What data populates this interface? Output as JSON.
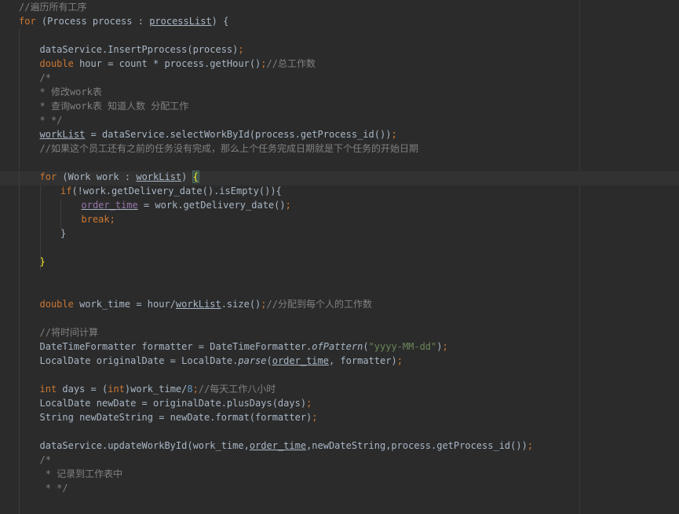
{
  "editor": {
    "lines": [
      {
        "i": 0,
        "text": "//遍历所有工序"
      },
      {
        "i": 0,
        "text": "for (Process process : processList) {"
      },
      {
        "i": 1,
        "text": ""
      },
      {
        "i": 1,
        "text": "dataService.InsertPprocess(process);"
      },
      {
        "i": 1,
        "text": "double hour = count * process.getHour();//总工作数"
      },
      {
        "i": 1,
        "text": "/*"
      },
      {
        "i": 1,
        "text": "* 修改work表"
      },
      {
        "i": 1,
        "text": "* 查询work表 知道人数 分配工作"
      },
      {
        "i": 1,
        "text": "* */"
      },
      {
        "i": 1,
        "text": "workList = dataService.selectWorkById(process.getProcess_id());"
      },
      {
        "i": 1,
        "text": "//如果这个员工还有之前的任务没有完成，那么上个任务完成日期就是下个任务的开始日期"
      },
      {
        "i": 1,
        "text": ""
      },
      {
        "i": 1,
        "text": "for (Work work : workList) {"
      },
      {
        "i": 2,
        "text": "if(!work.getDelivery_date().isEmpty()){"
      },
      {
        "i": 3,
        "text": "order_time = work.getDelivery_date();"
      },
      {
        "i": 3,
        "text": "break;"
      },
      {
        "i": 2,
        "text": "}"
      },
      {
        "i": 1,
        "text": ""
      },
      {
        "i": 1,
        "text": "}"
      },
      {
        "i": 1,
        "text": ""
      },
      {
        "i": 1,
        "text": ""
      },
      {
        "i": 1,
        "text": "double work_time = hour/workList.size();//分配到每个人的工作数"
      },
      {
        "i": 1,
        "text": ""
      },
      {
        "i": 1,
        "text": "//将时间计算"
      },
      {
        "i": 1,
        "text": "DateTimeFormatter formatter = DateTimeFormatter.ofPattern(\"yyyy-MM-dd\");"
      },
      {
        "i": 1,
        "text": "LocalDate originalDate = LocalDate.parse(order_time, formatter);"
      },
      {
        "i": 1,
        "text": ""
      },
      {
        "i": 1,
        "text": "int days = (int)work_time/8;//每天工作八小时"
      },
      {
        "i": 1,
        "text": "LocalDate newDate = originalDate.plusDays(days);"
      },
      {
        "i": 1,
        "text": "String newDateString = newDate.format(formatter);"
      },
      {
        "i": 1,
        "text": ""
      },
      {
        "i": 1,
        "text": "dataService.updateWorkById(work_time,order_time,newDateString,process.getProcess_id());"
      },
      {
        "i": 1,
        "text": "/*"
      },
      {
        "i": 1,
        "text": " * 记录到工作表中"
      },
      {
        "i": 1,
        "text": " * */"
      }
    ],
    "theme": {
      "background": "#2b2b2b",
      "keyword": "#cc7832",
      "comment": "#808080",
      "string": "#6a8759",
      "number": "#6897bb",
      "field": "#9876aa",
      "text": "#a9b7c6",
      "matched_brace": "#ffef28"
    }
  }
}
